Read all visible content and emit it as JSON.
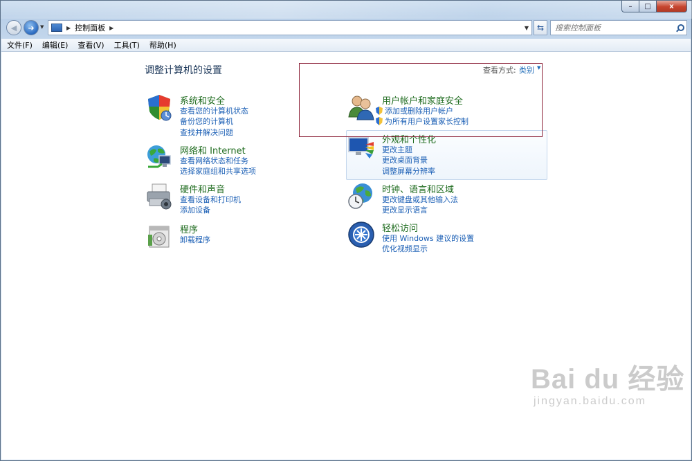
{
  "window": {
    "controls": {
      "minimize": "–",
      "maximize": "□",
      "close": "x"
    }
  },
  "nav": {
    "back_glyph": "◀",
    "forward_glyph": "➜",
    "address_segment": "控制面板",
    "search_placeholder": "搜索控制面板"
  },
  "menu": [
    "文件(F)",
    "编辑(E)",
    "查看(V)",
    "工具(T)",
    "帮助(H)"
  ],
  "content": {
    "title": "调整计算机的设置",
    "view_by_label": "查看方式:",
    "view_by_value": "类别"
  },
  "categories": [
    {
      "title": "系统和安全",
      "icon": "shield-icon",
      "links": [
        "查看您的计算机状态",
        "备份您的计算机",
        "查找并解决问题"
      ]
    },
    {
      "title": "网络和 Internet",
      "icon": "network-icon",
      "links": [
        "查看网络状态和任务",
        "选择家庭组和共享选项"
      ]
    },
    {
      "title": "硬件和声音",
      "icon": "printer-icon",
      "links": [
        "查看设备和打印机",
        "添加设备"
      ]
    },
    {
      "title": "程序",
      "icon": "programs-icon",
      "links": [
        "卸载程序"
      ]
    },
    {
      "title": "用户帐户和家庭安全",
      "icon": "users-icon",
      "links": [
        "添加或删除用户帐户",
        "为所有用户设置家长控制"
      ]
    },
    {
      "title": "外观和个性化",
      "icon": "appearance-icon",
      "links": [
        "更改主题",
        "更改桌面背景",
        "调整屏幕分辨率"
      ]
    },
    {
      "title": "时钟、语言和区域",
      "icon": "globe-clock-icon",
      "links": [
        "更改键盘或其他输入法",
        "更改显示语言"
      ]
    },
    {
      "title": "轻松访问",
      "icon": "ease-of-access-icon",
      "links": [
        "使用 Windows 建议的设置",
        "优化视频显示"
      ]
    }
  ],
  "watermark": {
    "main": "Bai du 经验",
    "sub": "jingyan.baidu.com"
  }
}
